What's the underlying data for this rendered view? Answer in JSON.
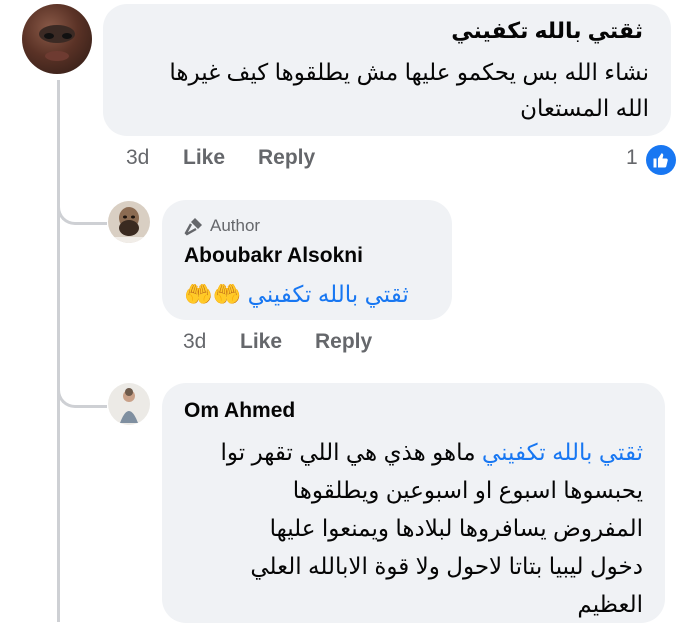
{
  "comment1": {
    "author": "ثقتي بالله تكفيني",
    "line1": "نشاء الله بس يحكمو عليها مش يطلقوها كيف غيرها",
    "line2": "الله المستعان",
    "time": "3d",
    "like": "Like",
    "reply": "Reply",
    "reactions_count": "1",
    "reaction_icon": "like-thumb-icon"
  },
  "reply1": {
    "badge": "Author",
    "author": "Aboubakr Alsokni",
    "mention": "ثقتي بالله تكفيني",
    "emoji": "🤲🤲",
    "time": "3d",
    "like": "Like",
    "reply": "Reply"
  },
  "reply2": {
    "author": "Om Ahmed",
    "mention": "ثقتي بالله تكفيني",
    "line1_rest": " ماهو هذي هي اللي تقهر  توا",
    "line2": "يحبسوها اسبوع او اسبوعين ويطلقوها",
    "line3": "المفروض يسافروها لبلادها ويمنعوا عليها",
    "line4": "دخول ليبيا بتاتا لاحول ولا قوة الابالله العلي",
    "line5": "العظيم"
  },
  "colors": {
    "bubble": "#f0f2f5",
    "link": "#1877f2",
    "meta": "#65676b",
    "thread": "#ced0d4"
  }
}
